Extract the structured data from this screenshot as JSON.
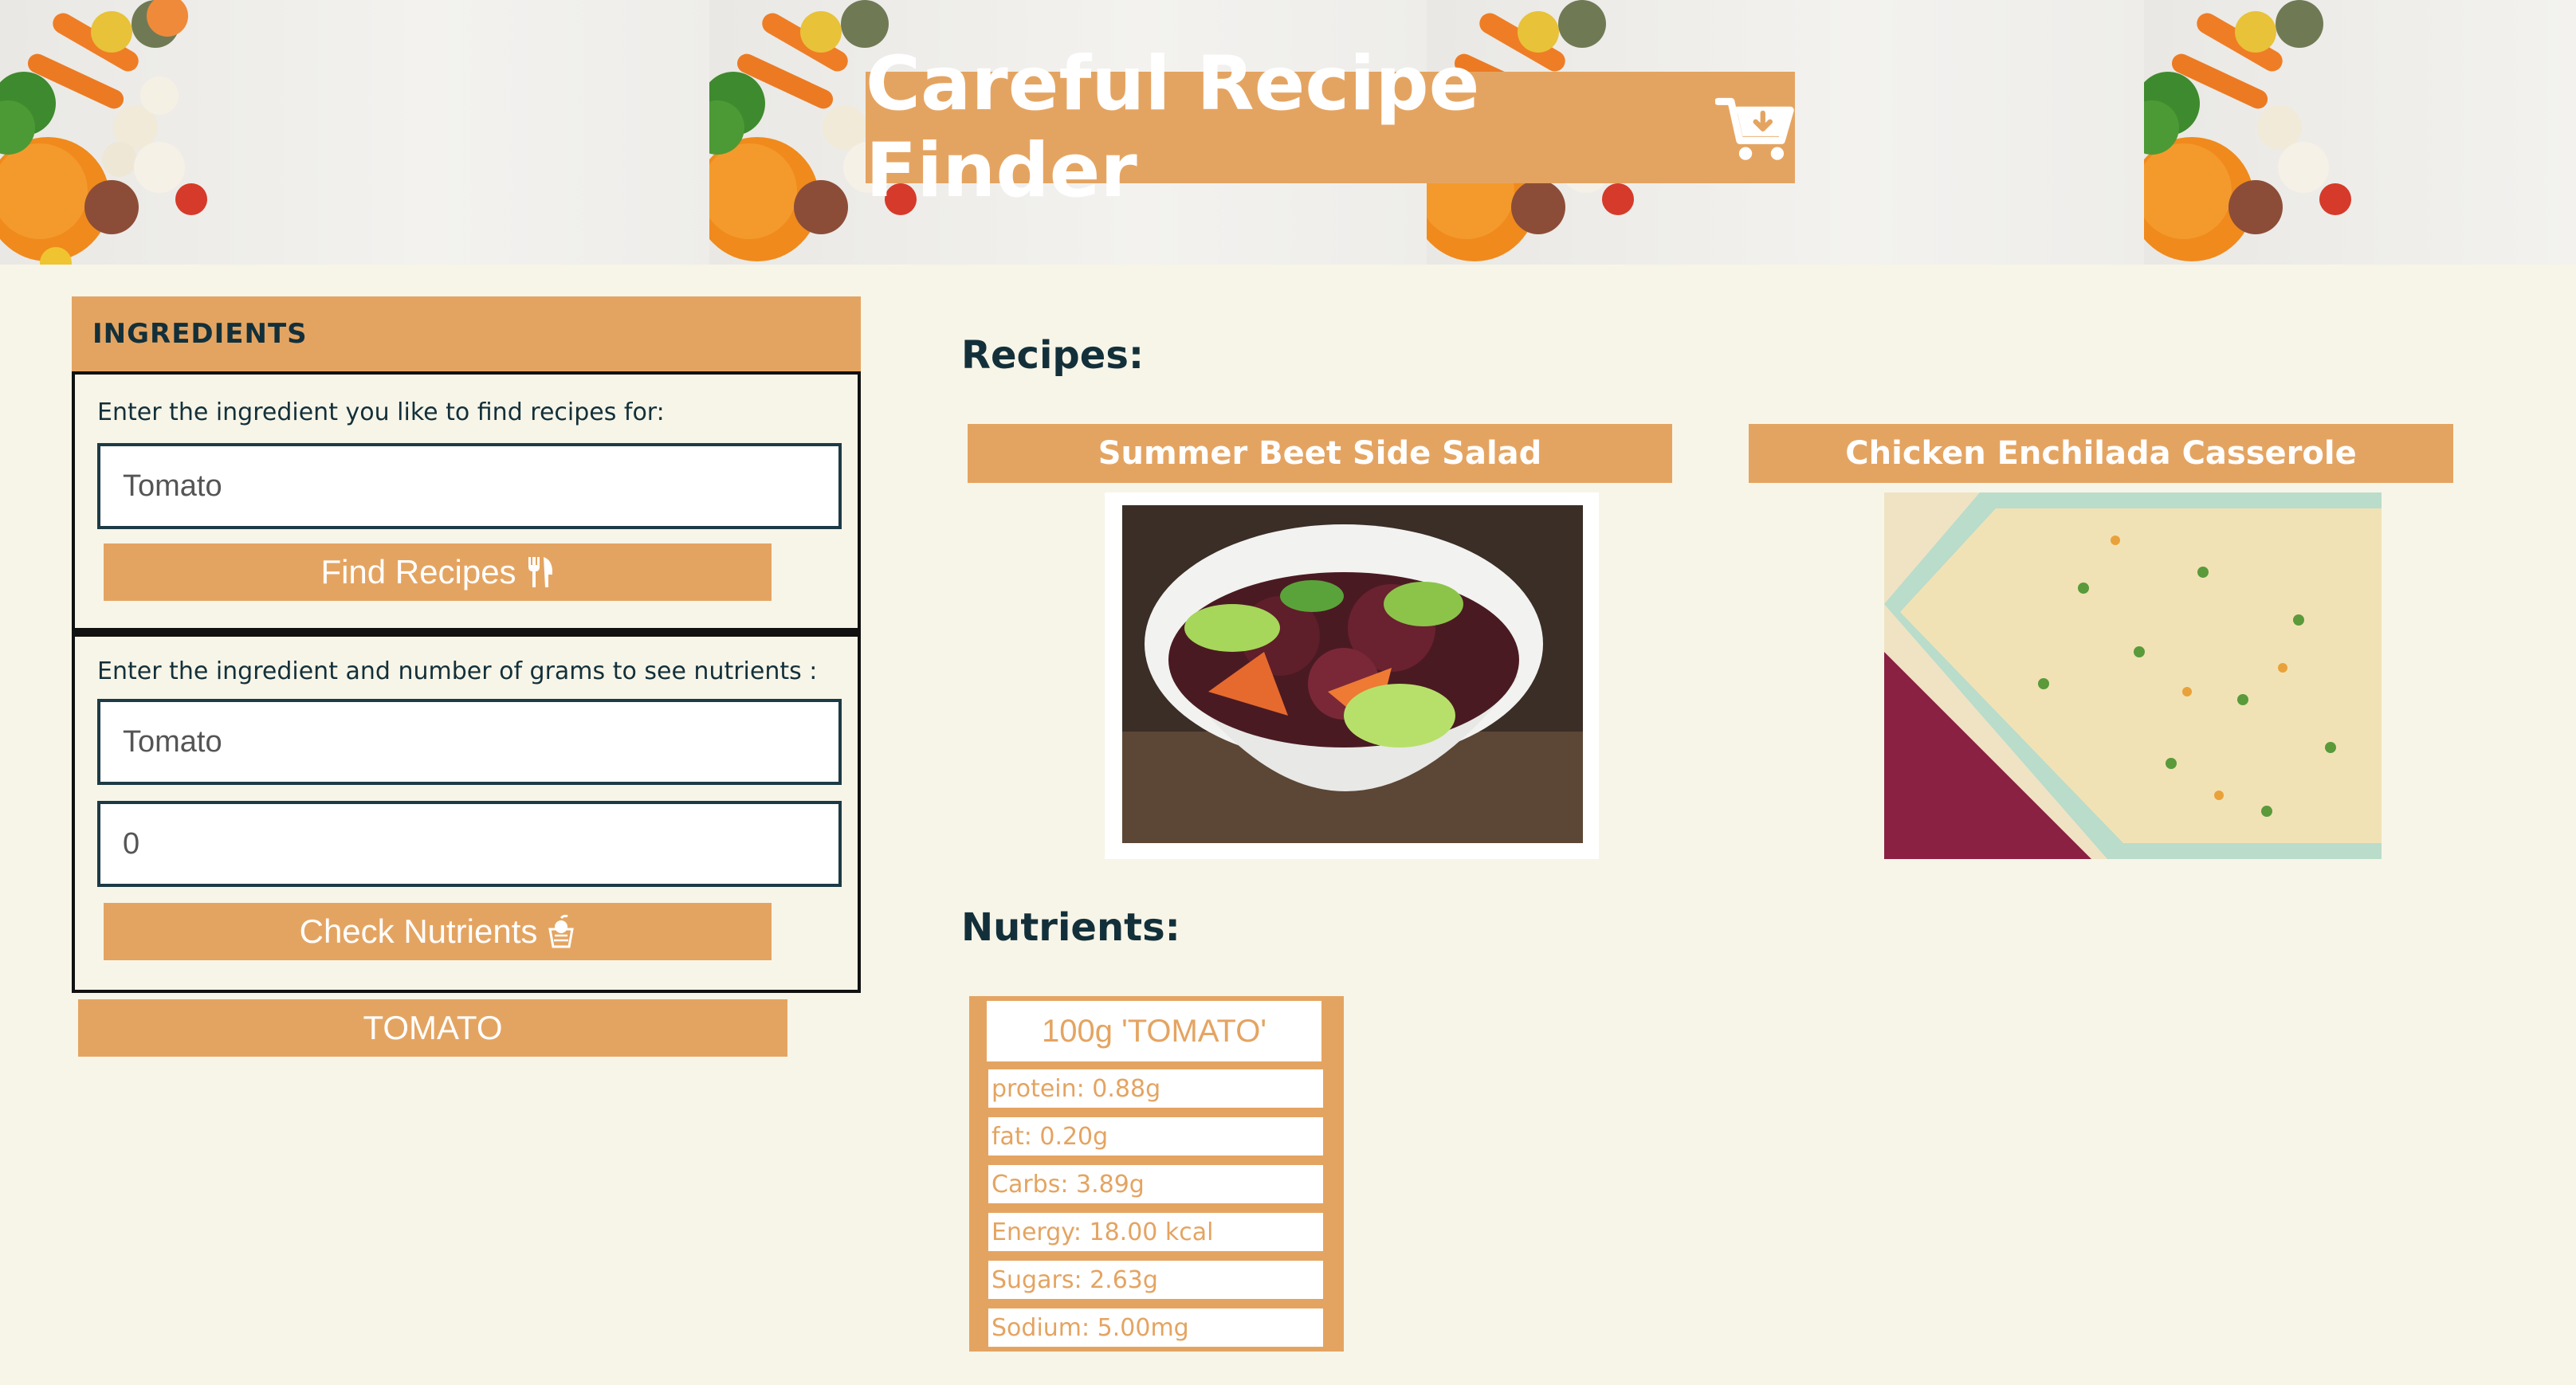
{
  "header": {
    "title": "Careful Recipe Finder",
    "icon": "cart-download-icon"
  },
  "ingredients": {
    "header": "INGREDIENTS",
    "recipe_search": {
      "label": "Enter the ingredient you like to find recipes for:",
      "value": "Tomato",
      "button_label": "Find Recipes",
      "button_icon": "utensils-icon"
    },
    "nutrient_check": {
      "label": "Enter the ingredient and number of grams to see nutrients :",
      "ingredient_value": "Tomato",
      "grams_value": "0",
      "button_label": "Check Nutrients",
      "button_icon": "apple-basket-icon"
    },
    "selected_item": "TOMATO"
  },
  "recipes": {
    "heading": "Recipes:",
    "items": [
      {
        "title": "Summer Beet Side Salad"
      },
      {
        "title": "Chicken Enchilada Casserole"
      }
    ]
  },
  "nutrients": {
    "heading": "Nutrients:",
    "panel_title": "100g 'TOMATO'",
    "rows": [
      "protein: 0.88g",
      "fat: 0.20g",
      "Carbs: 3.89g",
      "Energy: 18.00 kcal",
      "Sugars: 2.63g",
      "Sodium: 5.00mg"
    ]
  },
  "colors": {
    "accent": "#e4a461",
    "background": "#f7f5e8",
    "text_dark": "#13303a"
  }
}
